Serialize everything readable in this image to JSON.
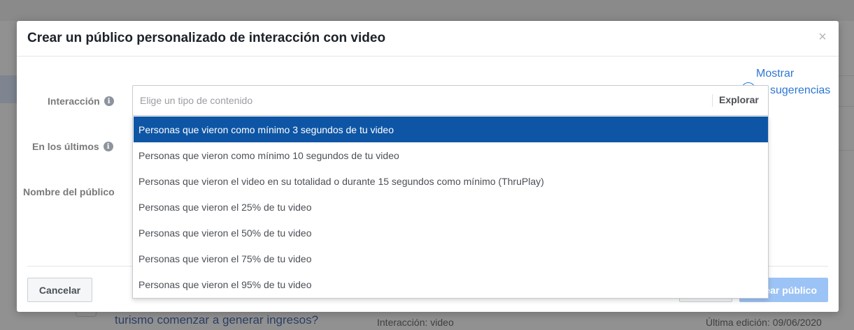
{
  "background": {
    "question_text": "turismo comenzar a generar ingresos?",
    "interaction_text": "Interacción: video",
    "last_edit_text": "Última edición: 09/06/2020"
  },
  "modal": {
    "title": "Crear un público personalizado de interacción con video",
    "close_glyph": "×",
    "suggestions_line1": "Mostrar",
    "suggestions_line2": "sugerencias",
    "labels": {
      "interaction": "Interacción",
      "last_days": "En los últimos",
      "audience_name": "Nombre del público"
    },
    "combo": {
      "placeholder": "Elige un tipo de contenido",
      "explore_label": "Explorar"
    },
    "options": [
      {
        "label": "Personas que vieron como mínimo 3 segundos de tu video",
        "selected": true
      },
      {
        "label": "Personas que vieron como mínimo 10 segundos de tu video",
        "selected": false
      },
      {
        "label": "Personas que vieron el video en su totalidad o durante 15 segundos como mínimo (ThruPlay)",
        "selected": false
      },
      {
        "label": "Personas que vieron el 25% de tu video",
        "selected": false
      },
      {
        "label": "Personas que vieron el 50% de tu video",
        "selected": false
      },
      {
        "label": "Personas que vieron el 75% de tu video",
        "selected": false
      },
      {
        "label": "Personas que vieron el 95% de tu video",
        "selected": false
      }
    ],
    "footer": {
      "cancel_label": "Cancelar",
      "create_label": "Crear público"
    }
  },
  "colors": {
    "accent": "#2d77d3",
    "selected_option": "#0e56a5",
    "primary_disabled": "#9cc3f5"
  }
}
